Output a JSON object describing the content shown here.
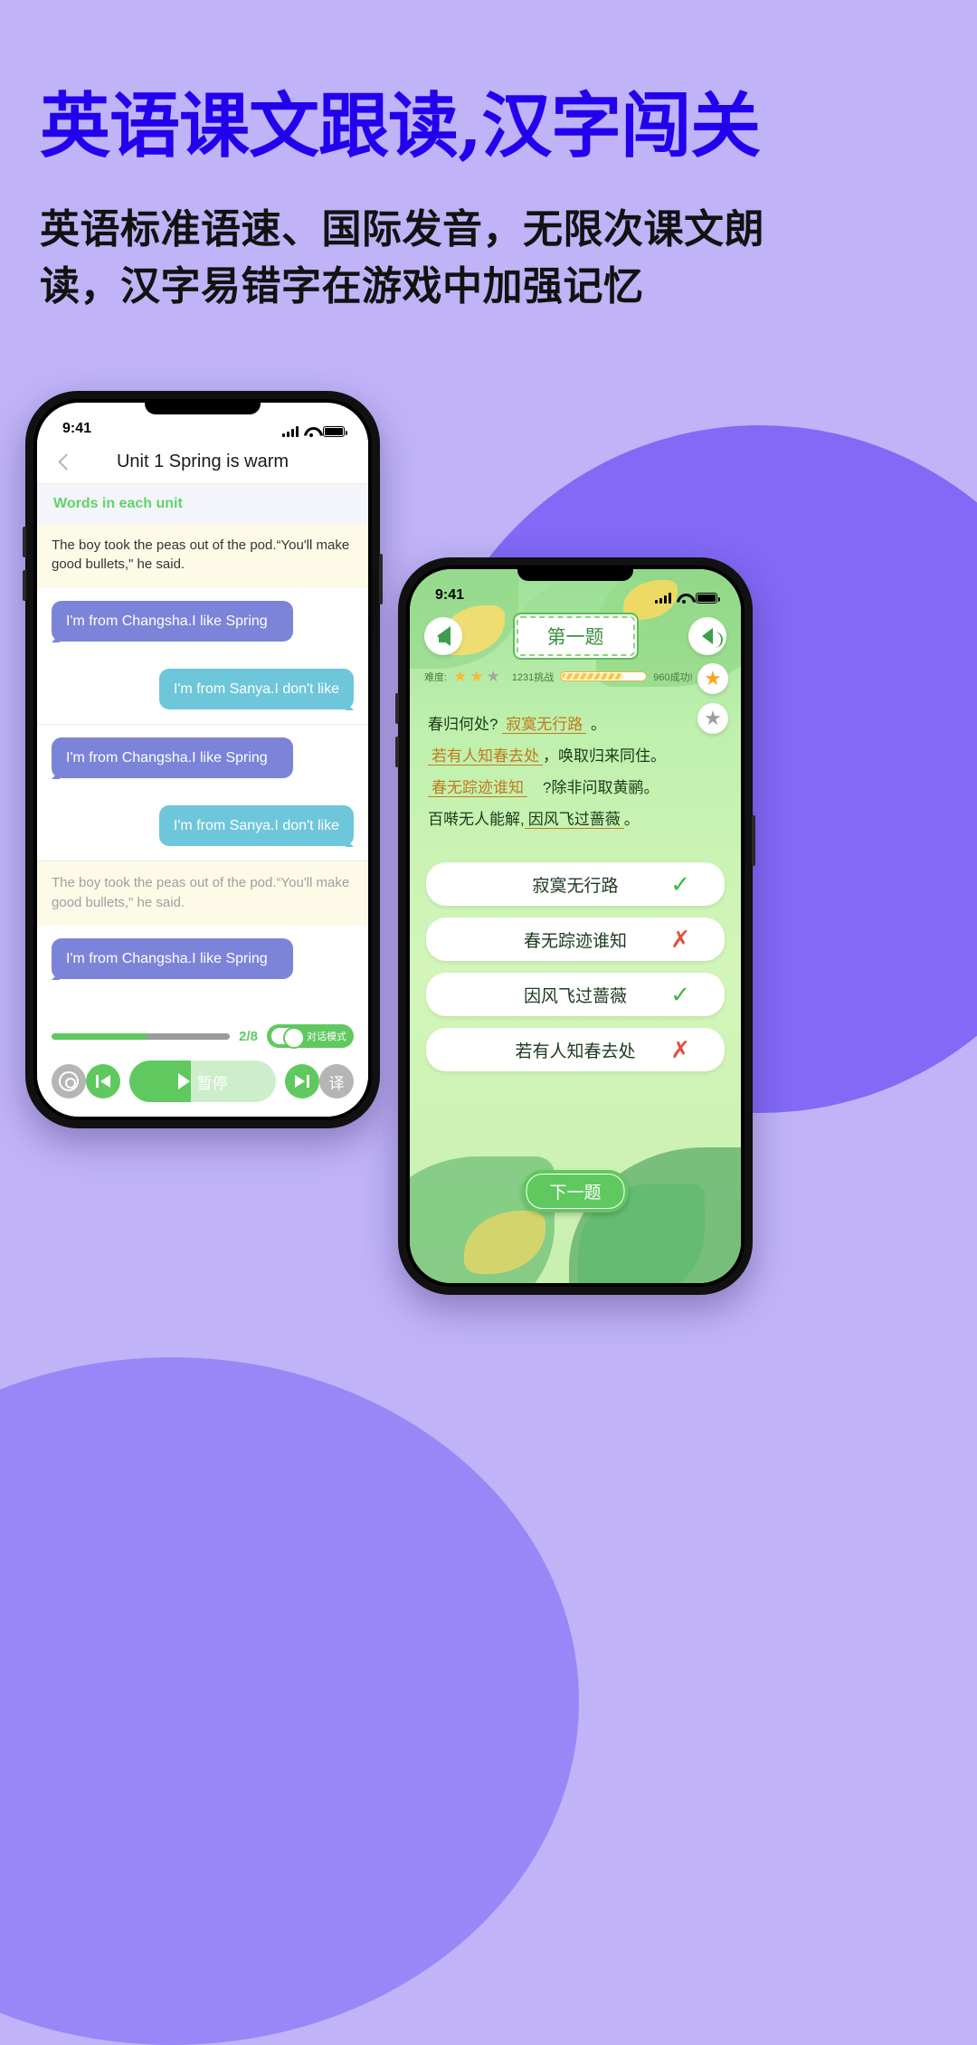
{
  "hero": {
    "title": "英语课文跟读,汉字闯关",
    "subtitle": "英语标准语速、国际发音，无限次课文朗读，汉字易错字在游戏中加强记忆"
  },
  "phone1": {
    "status": {
      "time": "9:41"
    },
    "nav": {
      "back_icon": "chevron-left-icon",
      "title": "Unit 1 Spring is warm"
    },
    "section_header": "Words in each unit",
    "paragraph": "The boy took the peas out of the pod.“You'll make good bullets,\" he said.",
    "paragraph2": "The boy took the peas out of the pod.“You'll make good bullets,\" he said.",
    "bubbles": [
      {
        "side": "left",
        "text": "I'm from Changsha.I like Spring"
      },
      {
        "side": "right",
        "text": "I'm from Sanya.I  don't like"
      },
      {
        "side": "left",
        "text": "I'm from Changsha.I like Spring"
      },
      {
        "side": "right",
        "text": "I'm from Sanya.I  don't like"
      },
      {
        "side": "left",
        "text": "I'm from Changsha.I like Spring"
      }
    ],
    "progress": {
      "counter": "2/8",
      "percent": 54
    },
    "toggle": {
      "label": "对话模式",
      "on": true
    },
    "controls": {
      "settings_icon": "gear-icon",
      "prev_icon": "skip-previous-icon",
      "play_label": "暂停",
      "play_icon": "play-icon",
      "next_icon": "skip-next-icon",
      "translate_label": "译"
    },
    "colors": {
      "accent_green": "#5fc95f",
      "bubble_left": "#7b84d8",
      "bubble_right": "#6ec6da"
    }
  },
  "phone2": {
    "status": {
      "time": "9:41"
    },
    "header": {
      "back_icon": "back-arrow-icon",
      "question_label": "第一题",
      "sound_icon": "speaker-icon"
    },
    "meta": {
      "difficulty_label": "难度:",
      "stars_filled": 2,
      "stars_total": 3,
      "challenge_count": "1231挑战",
      "success_count": "960成功!",
      "progress_percent": 72
    },
    "side_badges": [
      {
        "icon": "star-icon",
        "state": "active"
      },
      {
        "icon": "star-icon",
        "state": "inactive"
      }
    ],
    "poem": [
      {
        "parts": [
          {
            "t": "春归何处?",
            "s": "plain"
          },
          {
            "t": "寂寞无行路",
            "s": "blank"
          },
          {
            "t": "。",
            "s": "plain"
          }
        ]
      },
      {
        "parts": [
          {
            "t": "若有人知春去处",
            "s": "underline"
          },
          {
            "t": "，唤取归来同住。",
            "s": "plain"
          }
        ]
      },
      {
        "parts": [
          {
            "t": "春无踪迹谁知",
            "s": "underline"
          },
          {
            "t": "　?除非问取黄鹂。",
            "s": "plain"
          }
        ]
      },
      {
        "parts": [
          {
            "t": "百啭无人能解,",
            "s": "plain"
          },
          {
            "t": "因风飞过蔷薇",
            "s": "blank"
          },
          {
            "t": "。",
            "s": "plain"
          }
        ]
      }
    ],
    "options": [
      {
        "text": "寂寞无行路",
        "result": "correct"
      },
      {
        "text": "春无踪迹谁知",
        "result": "wrong"
      },
      {
        "text": "因风飞过蔷薇",
        "result": "correct"
      },
      {
        "text": "若有人知春去处",
        "result": "wrong"
      }
    ],
    "next_button": "下一题",
    "colors": {
      "bg_green": "#bff0ad",
      "accent": "#5fc95f",
      "underline": "#c07b1d"
    }
  }
}
